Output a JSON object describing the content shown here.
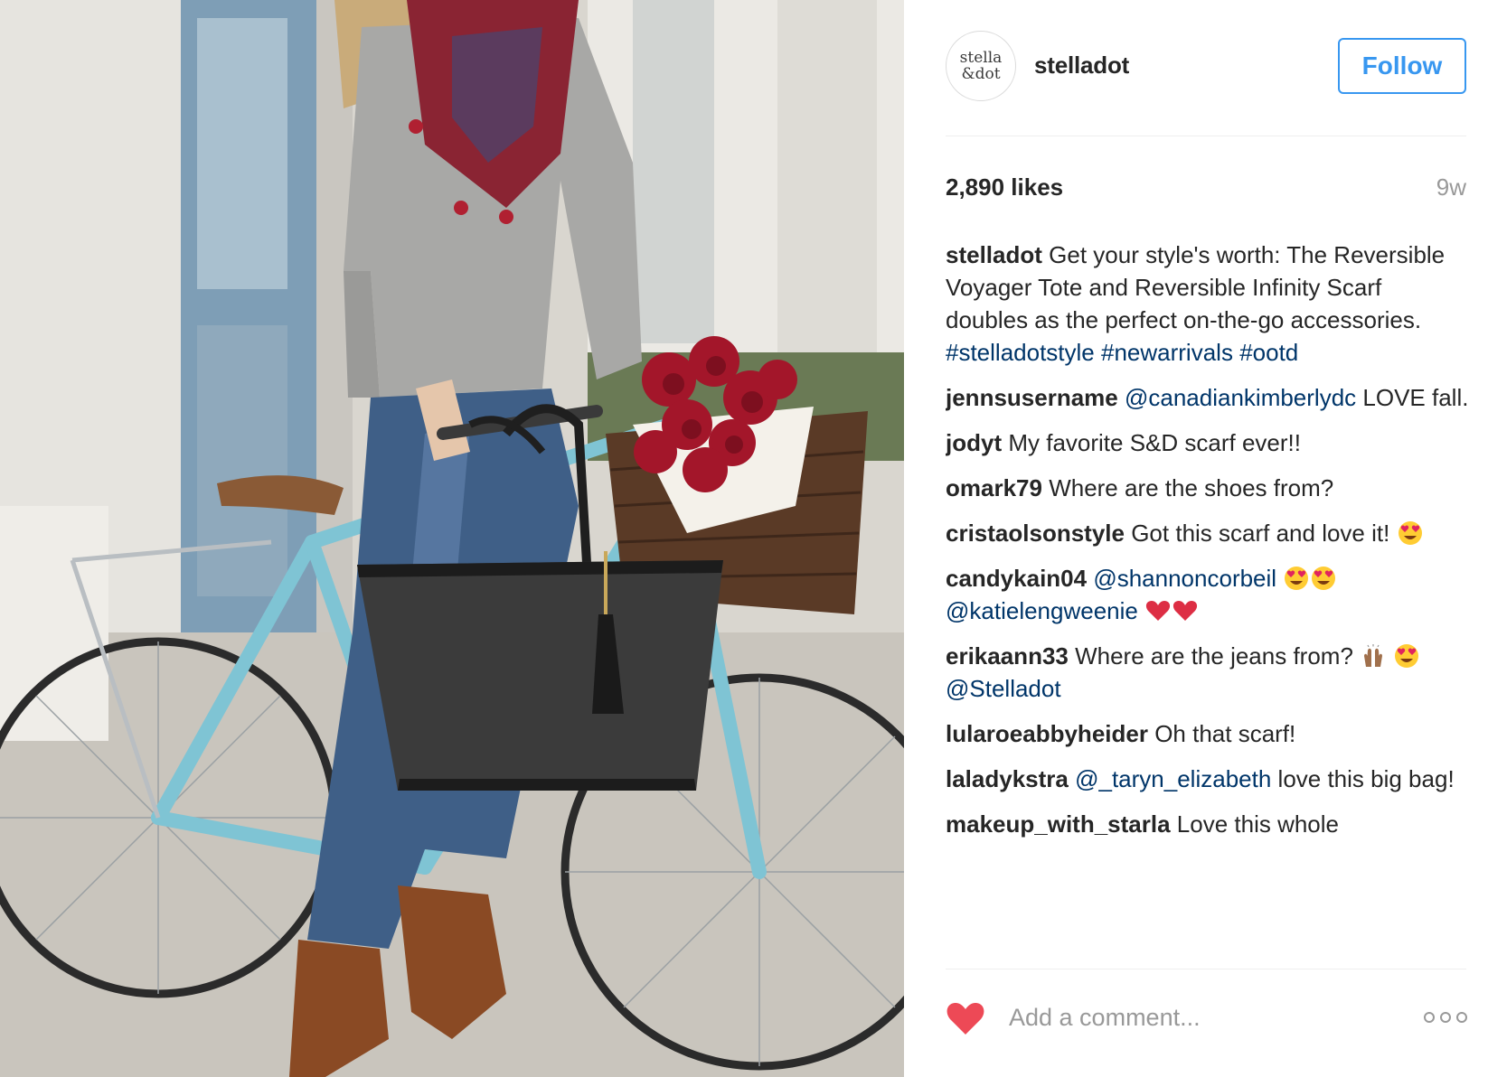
{
  "post": {
    "photo_alt": "Woman with a grey sweater and red scarf holding a black tote bag next to a light blue bicycle with a basket of red peonies",
    "account": {
      "avatar_line1": "stella",
      "avatar_line2": "&dot",
      "username": "stelladot",
      "follow_label": "Follow"
    },
    "likes": "2,890 likes",
    "time_ago": "9w",
    "comments": [
      {
        "user": "stelladot",
        "parts": [
          {
            "t": "text",
            "v": " Get your style's worth: The Reversible Voyager Tote and Reversible Infinity Scarf doubles as the perfect on-the-go accessories. "
          },
          {
            "t": "link",
            "v": "#stelladotstyle"
          },
          {
            "t": "text",
            "v": " "
          },
          {
            "t": "link",
            "v": "#newarrivals"
          },
          {
            "t": "text",
            "v": " "
          },
          {
            "t": "link",
            "v": "#ootd"
          }
        ]
      },
      {
        "user": "jennsusername",
        "parts": [
          {
            "t": "text",
            "v": " "
          },
          {
            "t": "link",
            "v": "@canadiankimberlydc"
          },
          {
            "t": "text",
            "v": " LOVE fall."
          }
        ]
      },
      {
        "user": "jodyt",
        "parts": [
          {
            "t": "text",
            "v": " My favorite S&D scarf ever!!"
          }
        ]
      },
      {
        "user": "omark79",
        "parts": [
          {
            "t": "text",
            "v": " Where are the shoes from?"
          }
        ]
      },
      {
        "user": "cristaolsonstyle",
        "parts": [
          {
            "t": "text",
            "v": " Got this scarf and love it! "
          },
          {
            "t": "emoji",
            "v": "heart-eyes"
          }
        ]
      },
      {
        "user": "candykain04",
        "parts": [
          {
            "t": "text",
            "v": " "
          },
          {
            "t": "link",
            "v": "@shannoncorbeil"
          },
          {
            "t": "text",
            "v": " "
          },
          {
            "t": "emoji",
            "v": "heart-eyes"
          },
          {
            "t": "emoji",
            "v": "heart-eyes"
          },
          {
            "t": "text",
            "v": " "
          },
          {
            "t": "link",
            "v": "@katielengweenie"
          },
          {
            "t": "text",
            "v": " "
          },
          {
            "t": "emoji",
            "v": "red-heart"
          },
          {
            "t": "emoji",
            "v": "red-heart"
          }
        ]
      },
      {
        "user": "erikaann33",
        "parts": [
          {
            "t": "text",
            "v": " Where are the jeans from? "
          },
          {
            "t": "emoji",
            "v": "raised-hands"
          },
          {
            "t": "text",
            "v": " "
          },
          {
            "t": "emoji",
            "v": "heart-eyes"
          },
          {
            "t": "link",
            "v": "@Stelladot"
          }
        ]
      },
      {
        "user": "lularoeabbyheider",
        "parts": [
          {
            "t": "text",
            "v": " Oh that scarf!"
          }
        ]
      },
      {
        "user": "laladykstra",
        "parts": [
          {
            "t": "text",
            "v": " "
          },
          {
            "t": "link",
            "v": "@_taryn_elizabeth"
          },
          {
            "t": "text",
            "v": " love this big bag!"
          }
        ]
      },
      {
        "user": "makeup_with_starla",
        "parts": [
          {
            "t": "text",
            "v": " Love this whole"
          }
        ]
      }
    ],
    "comment_placeholder": "Add a comment...",
    "icons": {
      "like": "heart-icon",
      "more": "more-options-icon"
    },
    "colors": {
      "follow_blue": "#3897f0",
      "link_navy": "#003569",
      "like_red": "#ed4956",
      "muted_grey": "#999999"
    }
  }
}
